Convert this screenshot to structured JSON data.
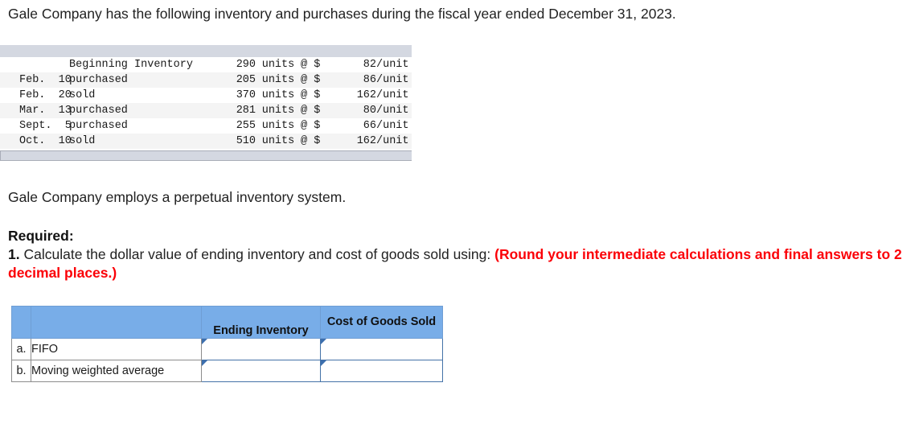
{
  "intro": {
    "text": "Gale Company has the following inventory and purchases during the fiscal year ended December 31, 2023."
  },
  "inventory_table": {
    "rows": [
      {
        "date": "",
        "desc": "Beginning Inventory",
        "qty": "290",
        "units": "units",
        "at": "@ $",
        "price": "82",
        "per": "/unit"
      },
      {
        "date": "Feb.  10",
        "desc": "purchased",
        "qty": "205",
        "units": "units",
        "at": "@ $",
        "price": "86",
        "per": "/unit"
      },
      {
        "date": "Feb.  20",
        "desc": "sold",
        "qty": "370",
        "units": "units",
        "at": "@ $",
        "price": "162",
        "per": "/unit"
      },
      {
        "date": "Mar.  13",
        "desc": "purchased",
        "qty": "281",
        "units": "units",
        "at": "@ $",
        "price": "80",
        "per": "/unit"
      },
      {
        "date": "Sept.  5",
        "desc": "purchased",
        "qty": "255",
        "units": "units",
        "at": "@ $",
        "price": "66",
        "per": "/unit"
      },
      {
        "date": "Oct.  10",
        "desc": "sold",
        "qty": "510",
        "units": "units",
        "at": "@ $",
        "price": "162",
        "per": "/unit"
      }
    ]
  },
  "perpetual": {
    "text": "Gale Company employs a perpetual inventory system."
  },
  "required": {
    "label": "Required:",
    "number": "1.",
    "question": " Calculate the dollar value of ending inventory and cost of goods sold using: ",
    "note": "(Round your intermediate calculations and final answers to 2 decimal places.)"
  },
  "answer_table": {
    "headers": {
      "index": "",
      "method": "",
      "ending_inventory": "Ending Inventory",
      "cost_of_goods_sold": "Cost of Goods Sold"
    },
    "rows": [
      {
        "index": "a.",
        "method": "FIFO",
        "ending_inventory": "",
        "cost_of_goods_sold": ""
      },
      {
        "index": "b.",
        "method": "Moving weighted average",
        "ending_inventory": "",
        "cost_of_goods_sold": ""
      }
    ]
  },
  "colors": {
    "header_blue": "#78ade8",
    "input_border": "#4472a8",
    "bar_gray": "#d4d8e1",
    "alert_red": "#fb0007"
  }
}
